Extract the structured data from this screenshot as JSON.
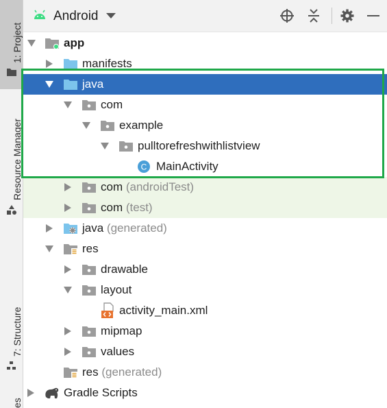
{
  "sidebar": {
    "project_label": "1: Project",
    "resource_label": "Resource Manager",
    "structure_label": "7: Structure",
    "bottom_label": "es"
  },
  "header": {
    "view_mode": "Android"
  },
  "tree": {
    "app": "app",
    "manifests": "manifests",
    "java": "java",
    "com": "com",
    "example": "example",
    "package": "pulltorefreshwithlistview",
    "main_activity": "MainActivity",
    "main_activity_badge": "C",
    "com_android_test": "com",
    "android_test_suffix": "(androidTest)",
    "com_test": "com",
    "test_suffix": "(test)",
    "java_generated": "java",
    "generated_suffix": "(generated)",
    "res": "res",
    "drawable": "drawable",
    "layout": "layout",
    "activity_main": "activity_main.xml",
    "mipmap": "mipmap",
    "values": "values",
    "res_generated": "res",
    "res_generated_suffix": "(generated)",
    "gradle_scripts": "Gradle Scripts"
  },
  "colors": {
    "selection": "#2f6ebd",
    "highlight_border": "#1fa849",
    "folder_blue": "#7cc4ec",
    "folder_gray": "#9c9c9c",
    "class_badge": "#4a9fd8",
    "android_green": "#3ddc84"
  }
}
